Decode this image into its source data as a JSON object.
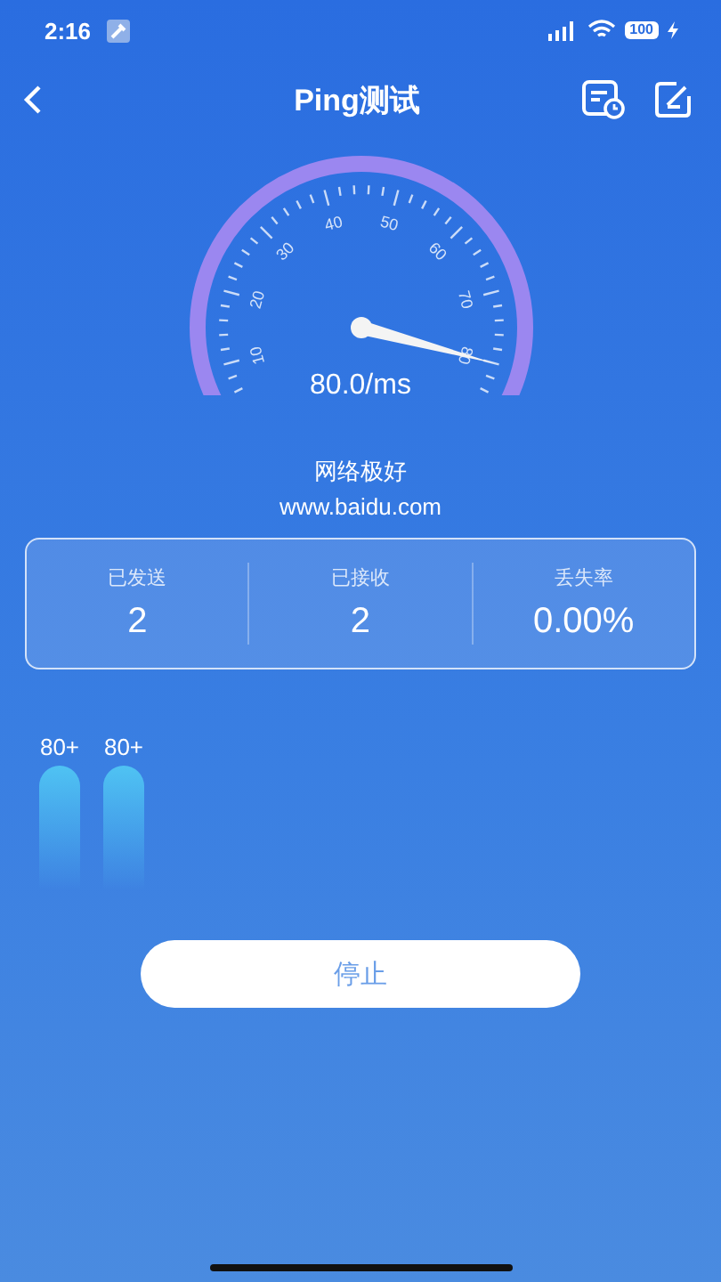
{
  "status_bar": {
    "time": "2:16",
    "battery": "100"
  },
  "header": {
    "title": "Ping测试"
  },
  "gauge": {
    "tick_labels": [
      "10",
      "20",
      "30",
      "40",
      "50",
      "60",
      "70",
      "80"
    ],
    "reading": "80.0/ms"
  },
  "quality": "网络极好",
  "host": "www.baidu.com",
  "stats": [
    {
      "label": "已发送",
      "value": "2"
    },
    {
      "label": "已接收",
      "value": "2"
    },
    {
      "label": "丢失率",
      "value": "0.00%"
    }
  ],
  "bars": [
    {
      "label": "80+"
    },
    {
      "label": "80+"
    }
  ],
  "stop_button": "停止"
}
